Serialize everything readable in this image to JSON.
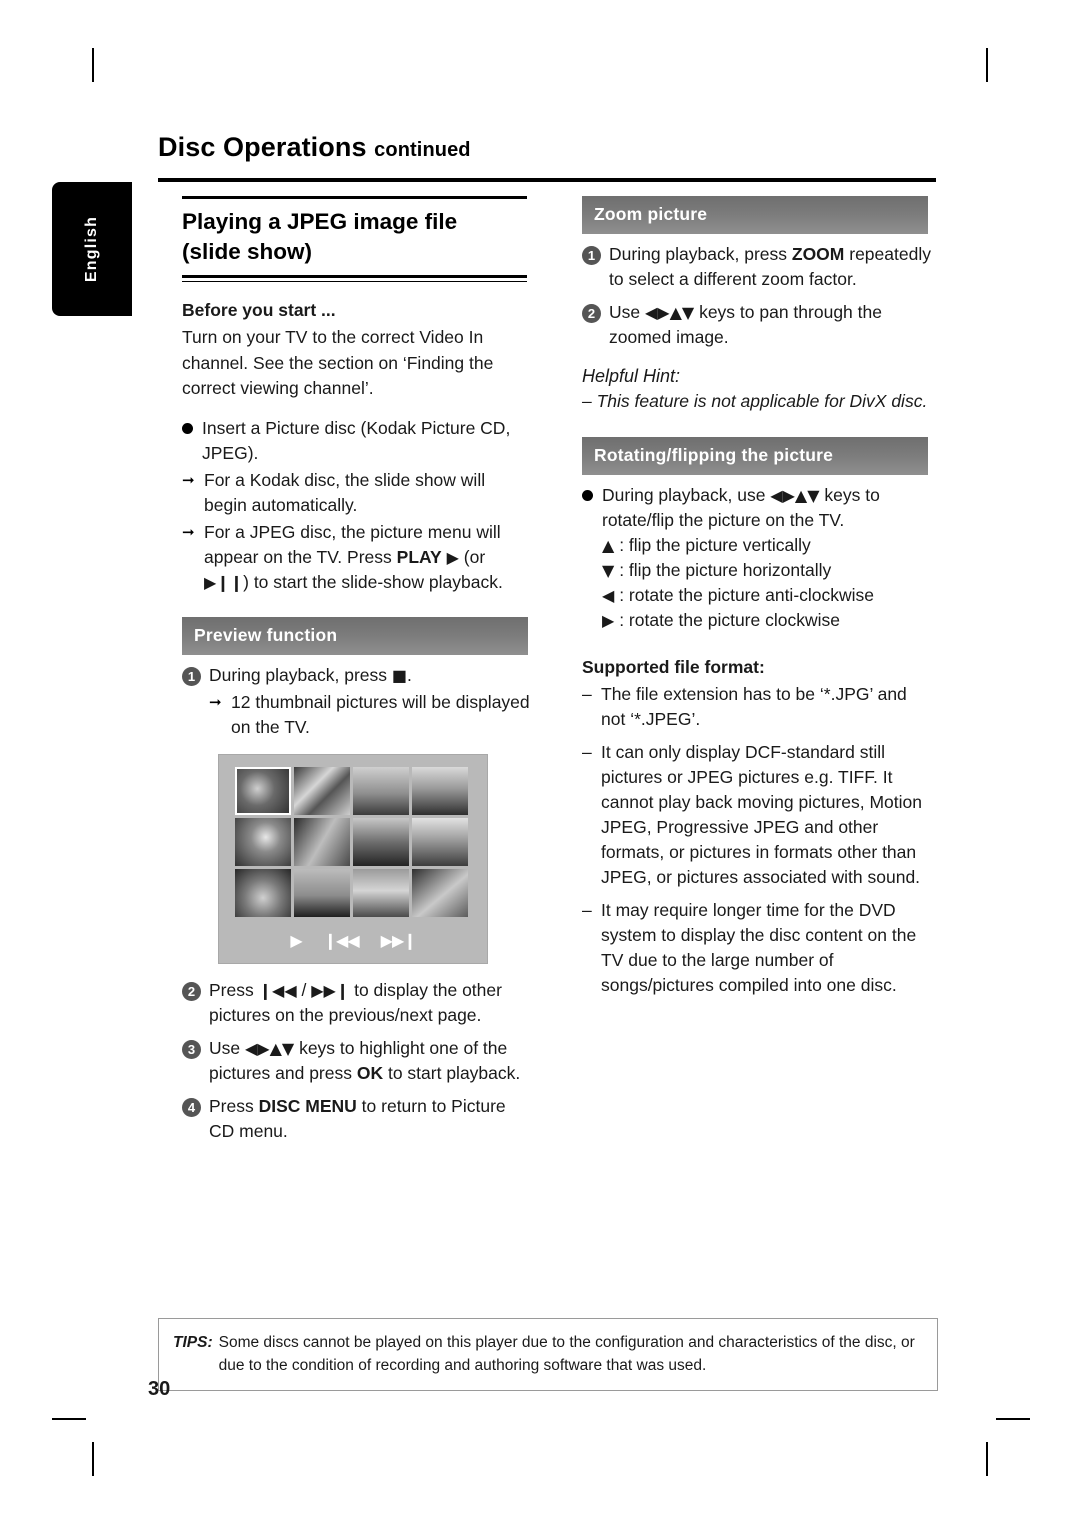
{
  "page": {
    "number": "30",
    "language_tab": "English",
    "chapter": "Disc Operations ",
    "chapter_continued": "continued"
  },
  "left": {
    "title_line1": "Playing a JPEG image file",
    "title_line2": "(slide show)",
    "before_head": "Before you start ...",
    "before_body": "Turn on your TV to the correct Video In channel.  See the section on ‘Finding the correct viewing channel’.",
    "bullet1": "Insert a Picture disc (Kodak Picture CD, JPEG).",
    "arrow1": "For a Kodak disc, the slide show will begin automatically.",
    "arrow2_a": "For a JPEG disc, the picture menu will appear on the TV.  Press ",
    "arrow2_play": "PLAY",
    "arrow2_b": " (or",
    "arrow2_c": ") to start the slide-show playback.",
    "preview_band": "Preview function",
    "step1_a": "During playback, press ",
    "step1_b": ".",
    "step1_arrow": "12 thumbnail pictures will be displayed on the TV.",
    "step2": "Press            /            to display the other pictures on the previous/next page.",
    "step2_a": "Press ",
    "step2_b": " / ",
    "step2_c": " to display the other pictures on the previous/next page.",
    "step3_a": "Use ",
    "step3_b": " keys to highlight one of the pictures and press ",
    "step3_ok": "OK",
    "step3_c": " to start playback.",
    "step4_a": "Press ",
    "step4_b": "DISC MENU",
    "step4_c": " to return to Picture CD menu."
  },
  "right": {
    "zoom_band": "Zoom picture",
    "zoom_step1_a": "During playback, press ",
    "zoom_step1_zoom": "ZOOM",
    "zoom_step1_b": " repeatedly to select a different zoom factor.",
    "zoom_step2_a": "Use ",
    "zoom_step2_b": " keys to pan through the zoomed image.",
    "hint_head": "Helpful Hint:",
    "hint_body": "–  This feature is not applicable for DivX disc.",
    "rotate_band": "Rotating/flipping the picture",
    "rotate_bullet_a": "During playback, use ",
    "rotate_bullet_b": " keys to rotate/flip the picture on the TV.",
    "key_up": ": flip the picture vertically",
    "key_down": ": flip the picture horizontally",
    "key_left": ": rotate the picture anti-clockwise",
    "key_right": ": rotate the picture clockwise",
    "format_head": "Supported file format:",
    "format_dash1": "The file extension has to be ‘*.JPG’ and not ‘*.JPEG’.",
    "format_dash2": "It can only display DCF-standard still pictures or JPEG pictures e.g. TIFF.  It cannot play back moving pictures, Motion JPEG, Progressive JPEG and other formats, or pictures in formats other than JPEG, or pictures associated with sound.",
    "format_dash3": "It may require longer time for the DVD system to display the disc content on the TV due to the large number of songs/pictures compiled into one disc."
  },
  "tips": {
    "label": "TIPS:",
    "body": "Some discs cannot be played on this player due to the configuration and characteristics of the disc, or due to the condition of recording and authoring software that was used."
  },
  "icons": {
    "play": "▶",
    "play_pause": "▶❙❙",
    "prev": "❘◀◀",
    "next": "▶▶❘",
    "stop": "■",
    "left": "◀",
    "right": "▶",
    "up": "▲",
    "down": "▼"
  }
}
